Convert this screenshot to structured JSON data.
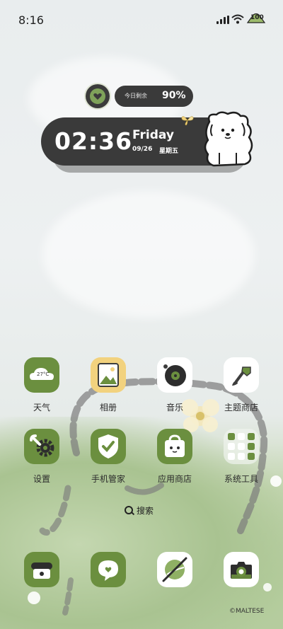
{
  "status_bar": {
    "time": "8:16",
    "battery": "100"
  },
  "widget": {
    "remaining_label": "今日剩余",
    "remaining_value": "90%",
    "clock_time": "02:36",
    "day": "Friday",
    "date": "09/26",
    "weekday": "星期五"
  },
  "apps": {
    "weather": {
      "label": "天气",
      "temp": "27°C"
    },
    "gallery": {
      "label": "相册"
    },
    "music": {
      "label": "音乐"
    },
    "themes": {
      "label": "主题商店"
    },
    "settings": {
      "label": "设置"
    },
    "phone_manager": {
      "label": "手机管家"
    },
    "app_store": {
      "label": "应用商店"
    },
    "system_tools": {
      "label": "系统工具"
    }
  },
  "search": {
    "label": "搜索"
  },
  "credit": "©MALTESE",
  "colors": {
    "accent_green": "#6b8f3f",
    "dark_pill": "#3a3a3a"
  }
}
